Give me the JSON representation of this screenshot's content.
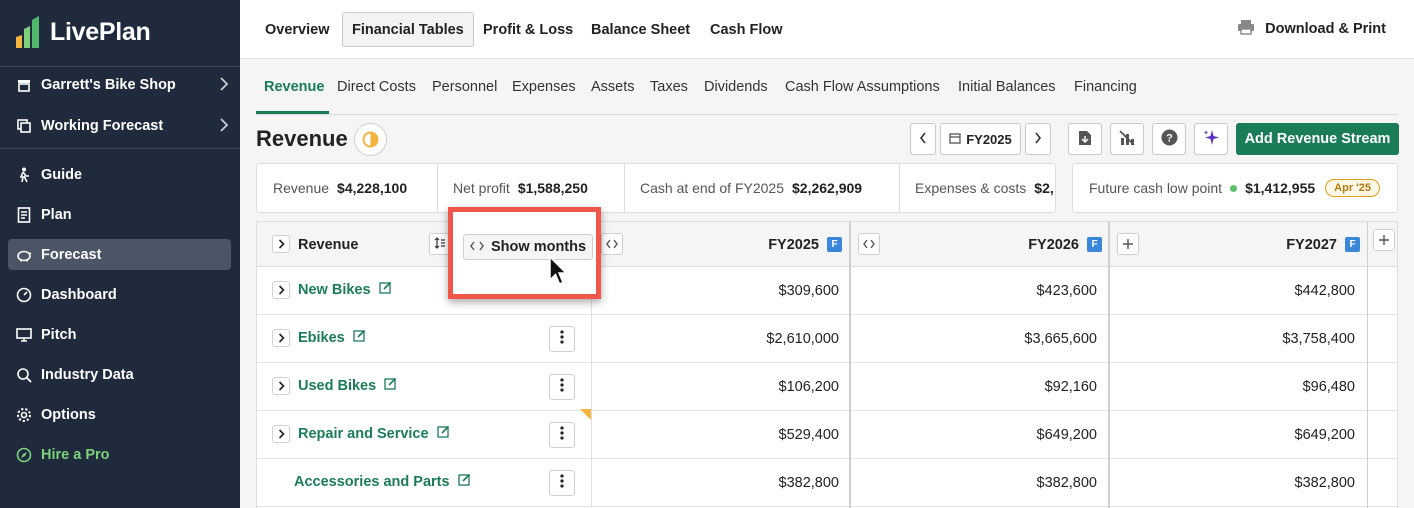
{
  "app": {
    "name": "LivePlan"
  },
  "sidebar": {
    "business": "Garrett's Bike Shop",
    "forecast": "Working Forecast",
    "items": [
      {
        "label": "Guide",
        "icon": "hiker-icon"
      },
      {
        "label": "Plan",
        "icon": "document-icon"
      },
      {
        "label": "Forecast",
        "icon": "piggy-bank-icon",
        "active": true
      },
      {
        "label": "Dashboard",
        "icon": "gauge-icon"
      },
      {
        "label": "Pitch",
        "icon": "monitor-icon"
      },
      {
        "label": "Industry Data",
        "icon": "magnifier-chart-icon"
      },
      {
        "label": "Options",
        "icon": "gear-icon"
      },
      {
        "label": "Hire a Pro",
        "icon": "compass-icon"
      }
    ]
  },
  "topnav": {
    "tabs": [
      "Overview",
      "Financial Tables",
      "Profit & Loss",
      "Balance Sheet",
      "Cash Flow"
    ],
    "selected": "Financial Tables",
    "download": "Download & Print"
  },
  "subnav": {
    "tabs": [
      "Revenue",
      "Direct Costs",
      "Personnel",
      "Expenses",
      "Assets",
      "Taxes",
      "Dividends",
      "Cash Flow Assumptions",
      "Initial Balances",
      "Financing"
    ],
    "selected": "Revenue"
  },
  "page": {
    "title": "Revenue",
    "year": "FY2025",
    "add_button": "Add Revenue Stream"
  },
  "summary": {
    "revenue_label": "Revenue",
    "revenue_value": "$4,228,100",
    "profit_label": "Net profit",
    "profit_value": "$1,588,250",
    "cash_label": "Cash at end of FY2025",
    "cash_value": "$2,262,909",
    "expenses_label": "Expenses & costs",
    "expenses_value": "$2,",
    "low_label": "Future cash low point",
    "low_value": "$1,412,955",
    "low_badge": "Apr '25"
  },
  "table": {
    "header": {
      "name": "Revenue",
      "cols": [
        "FY2025",
        "FY2026",
        "FY2027"
      ],
      "badge": "F"
    },
    "show_months": "Show months",
    "rows": [
      {
        "name": "New Bikes",
        "expandable": true,
        "values": [
          "$309,600",
          "$423,600",
          "$442,800"
        ]
      },
      {
        "name": "Ebikes",
        "expandable": true,
        "values": [
          "$2,610,000",
          "$3,665,600",
          "$3,758,400"
        ]
      },
      {
        "name": "Used Bikes",
        "expandable": true,
        "values": [
          "$106,200",
          "$92,160",
          "$96,480"
        ]
      },
      {
        "name": "Repair and Service",
        "expandable": true,
        "values": [
          "$529,400",
          "$649,200",
          "$649,200"
        ]
      },
      {
        "name": "Accessories and Parts",
        "expandable": false,
        "values": [
          "$382,800",
          "$382,800",
          "$382,800"
        ]
      }
    ]
  },
  "colors": {
    "sidebar_bg": "#1f2b3d",
    "brand_green": "#1b7d57",
    "highlight": "#f0574a",
    "hire_green": "#7ed17a"
  }
}
